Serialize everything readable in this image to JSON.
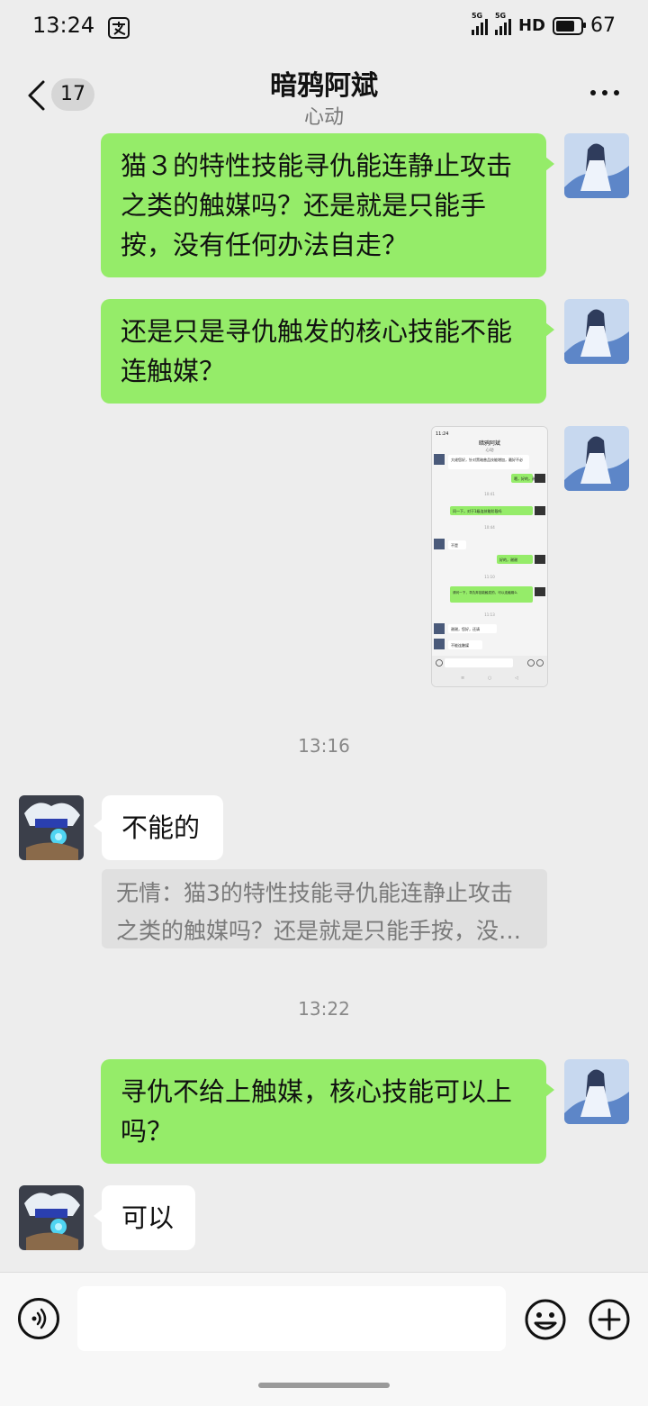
{
  "status_bar": {
    "time": "13:24",
    "app_icon": "alipay-icon",
    "network_1": "5G",
    "network_2": "5G",
    "hd": "HD",
    "battery": "67"
  },
  "header": {
    "unread_count": "17",
    "title": "暗鸦阿斌",
    "subtitle": "心动",
    "back_icon": "chevron-left-icon",
    "more_icon": "more-dots-icon"
  },
  "messages": [
    {
      "type": "text",
      "sender": "me",
      "text": "猫３的特性技能寻仇能连静止攻击之类的触媒吗？还是就是只能手按，没有任何办法自走？"
    },
    {
      "type": "text",
      "sender": "me",
      "text": "还是只是寻仇触发的核心技能不能连触媒？"
    },
    {
      "type": "image",
      "sender": "me"
    },
    {
      "type": "timestamp",
      "text": "13:16"
    },
    {
      "type": "text",
      "sender": "them",
      "text": "不能的"
    },
    {
      "type": "quote",
      "text": "无情：猫3的特性技能寻仇能连静止攻击之类的触媒吗？还是就是只能手按，没…"
    },
    {
      "type": "timestamp",
      "text": "13:22"
    },
    {
      "type": "text",
      "sender": "me",
      "text": "寻仇不给上触媒，核心技能可以上吗？"
    },
    {
      "type": "text",
      "sender": "them",
      "text": "可以"
    }
  ],
  "thumbnail": {
    "status_time": "11:24",
    "title": "暗鸦阿斌",
    "subtitle": "心动",
    "msg_1": "大佬您好，针对黑暗普品技能增加，最好不必",
    "msg_2": "嗯，好的，谢谢",
    "ts_1": "10:41",
    "msg_3": "问一下，对于1级连技能阶段吗",
    "ts_2": "10:44",
    "msg_4": "不是",
    "msg_5": "好的，谢谢",
    "ts_3": "11:10",
    "msg_6": "请问一下，寻仇弃技能触发的，可以连触媒么",
    "ts_4": "11:13",
    "msg_7": "谢谢，您好，还请",
    "msg_8": "不能连触媒"
  },
  "input_bar": {
    "placeholder": "",
    "voice_icon": "voice-icon",
    "emoji_icon": "emoji-icon",
    "plus_icon": "plus-icon"
  },
  "colors": {
    "background": "#ededed",
    "my_bubble": "#95ec69",
    "their_bubble": "#ffffff",
    "quote_bg": "#e0e0e0"
  }
}
